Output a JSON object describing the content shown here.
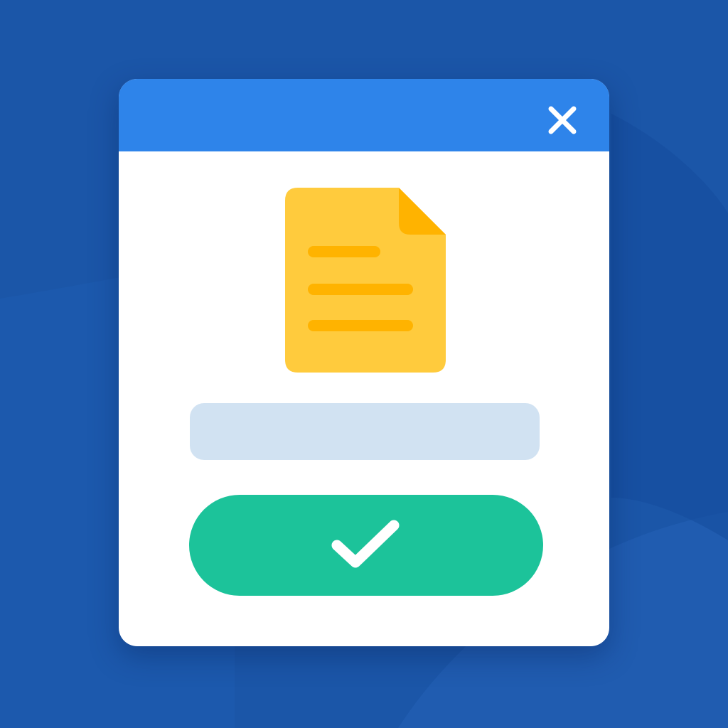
{
  "dialog": {
    "title": "",
    "close_icon": "close-icon",
    "file_icon": "document-icon",
    "field": {
      "value": "",
      "placeholder": ""
    },
    "confirm_icon": "checkmark-icon"
  },
  "colors": {
    "desktop_background": "#1b56a8",
    "titlebar": "#2e84ea",
    "dialog_body": "#ffffff",
    "document": "#ffcb3d",
    "document_lines": "#ffb300",
    "field_background": "#d1e2f2",
    "confirm_button": "#1cc39a",
    "icon_foreground": "#ffffff"
  }
}
